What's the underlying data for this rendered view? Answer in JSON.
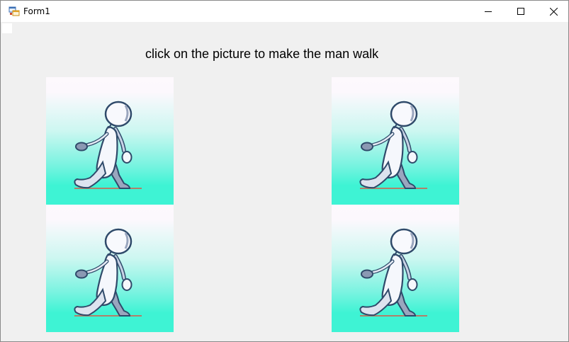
{
  "window": {
    "title": "Form1"
  },
  "instruction": {
    "text": "click on the picture to make the man walk"
  },
  "pictures": [
    {
      "icon": "walking-man-icon"
    },
    {
      "icon": "walking-man-icon"
    },
    {
      "icon": "walking-man-icon"
    },
    {
      "icon": "walking-man-icon"
    }
  ],
  "colors": {
    "picture_top": "#fcf8fd",
    "picture_bottom": "#3ef3d4",
    "window_bg": "#f0f0f0"
  }
}
